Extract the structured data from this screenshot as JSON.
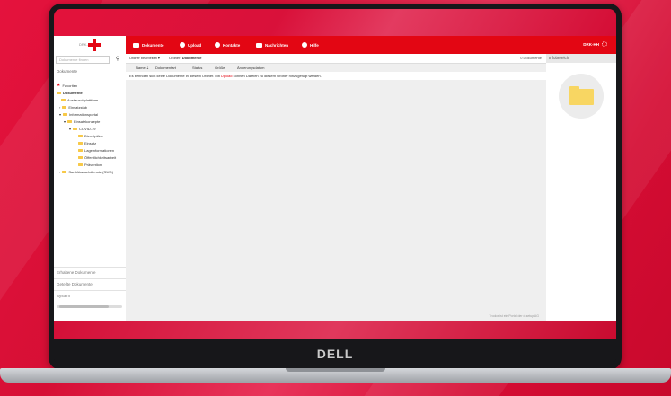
{
  "device": {
    "brand": "DELL"
  },
  "app": {
    "logo": {
      "text": "DRK-PLT"
    },
    "nav": [
      {
        "label": "Dokumente",
        "icon": "folder-icon"
      },
      {
        "label": "Upload",
        "icon": "upload-icon"
      },
      {
        "label": "Kontakte",
        "icon": "contacts-icon"
      },
      {
        "label": "Nachrichten",
        "icon": "mail-icon"
      },
      {
        "label": "Hilfe",
        "icon": "help-icon"
      }
    ],
    "user": {
      "label": "DRK-HH",
      "icon": "gear-icon"
    },
    "sidebar": {
      "search_placeholder": "Dokumente finden",
      "section_title": "Dokumente",
      "favorites": "Favoriten",
      "tree": [
        {
          "label": "Dokumente",
          "level": 0,
          "bold": true
        },
        {
          "label": "Austauschplattform",
          "level": 1
        },
        {
          "label": "Einsatzstab",
          "level": 1
        },
        {
          "label": "Informationsportal",
          "level": 1
        },
        {
          "label": "Einsatzkonzepte",
          "level": 2
        },
        {
          "label": "COVID-19",
          "level": 3
        },
        {
          "label": "Dienstpläne",
          "level": 4
        },
        {
          "label": "Einsatz",
          "level": 4
        },
        {
          "label": "Lageinformationen",
          "level": 4
        },
        {
          "label": "Öffentlichkeitsarbeit",
          "level": 4
        },
        {
          "label": "Prävention",
          "level": 4
        },
        {
          "label": "Sanitätswachdienste (SWD)",
          "level": 1
        }
      ],
      "footer": [
        "Erhaltene Dokumente",
        "Geteilte Dokumente",
        "System"
      ]
    },
    "toolbar": {
      "edit_button": "Ordner bearbeiten ▾",
      "folder_label": "Ordner:",
      "folder_name": "Dokumente",
      "count": "0 Dokumente"
    },
    "table": {
      "columns": [
        "Name ⇣",
        "Dokumentart",
        "Status",
        "Größe",
        "Änderungsdatum"
      ]
    },
    "empty": {
      "before": "Es befinden sich keine Dokumente in diesem Ordner. Mit ",
      "link": "Upload",
      "after": " können Dateien zu diesem Ordner hinzugefügt werden."
    },
    "footer_note": "Trodox ist ein Portal der d-setup AG",
    "info": {
      "title": "Infobereich"
    }
  }
}
